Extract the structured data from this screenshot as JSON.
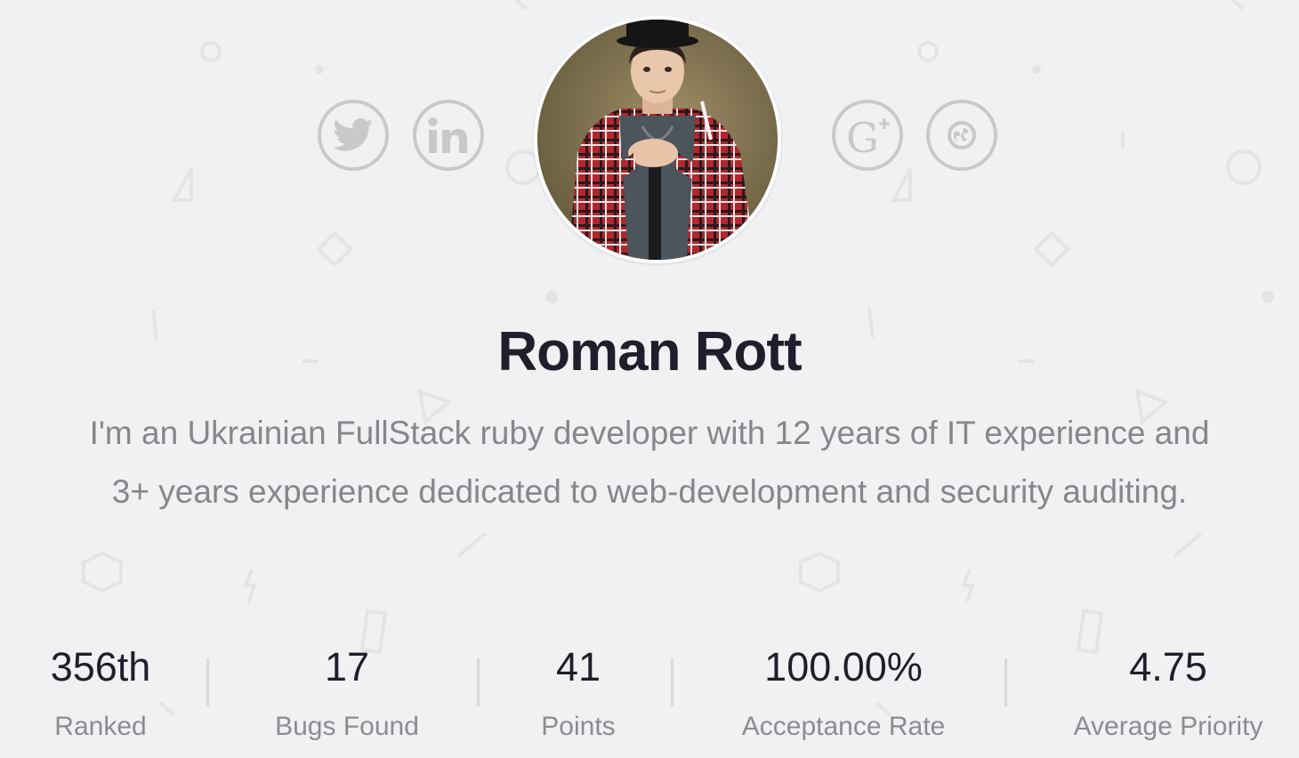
{
  "profile": {
    "name": "Roman Rott",
    "bio": "I'm an Ukrainian FullStack ruby developer with 12 years of IT experience and 3+ years experience dedicated to web-development and security auditing."
  },
  "social_links": [
    {
      "icon": "twitter-icon"
    },
    {
      "icon": "linkedin-icon"
    },
    {
      "icon": "google-plus-icon"
    },
    {
      "icon": "website-icon"
    }
  ],
  "stats": [
    {
      "value": "356th",
      "label": "Ranked"
    },
    {
      "value": "17",
      "label": "Bugs Found"
    },
    {
      "value": "41",
      "label": "Points"
    },
    {
      "value": "100.00%",
      "label": "Acceptance Rate"
    },
    {
      "value": "4.75",
      "label": "Average Priority"
    }
  ],
  "colors": {
    "background": "#f0f1f3",
    "name_text": "#1f1f2b",
    "bio_text": "#85878c",
    "icon_gray": "#c9c9cc"
  }
}
